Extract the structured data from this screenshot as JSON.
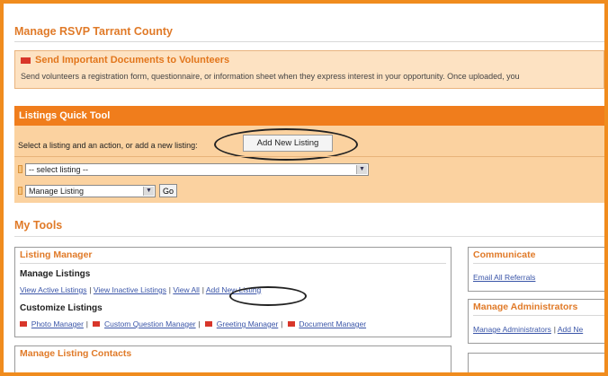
{
  "page": {
    "title": "Manage RSVP Tarrant County"
  },
  "notice": {
    "title": "Send Important Documents to Volunteers",
    "text": "Send volunteers a registration form, questionnaire, or information sheet when they express interest in your opportunity. Once uploaded, you"
  },
  "quick_tool": {
    "title": "Listings Quick Tool",
    "prompt": "Select a listing and an action, or add a new listing:",
    "add_button": "Add New Listing",
    "listing_select": {
      "value": "-- select listing --"
    },
    "action_select": {
      "value": "Manage Listing"
    },
    "go_button": "Go"
  },
  "tools": {
    "title": "My Tools",
    "listing_manager": {
      "title": "Listing Manager",
      "manage_heading": "Manage Listings",
      "manage_links": [
        "View Active Listings",
        "View Inactive Listings",
        "View All",
        "Add New Listing"
      ],
      "customize_heading": "Customize Listings",
      "customize_links": [
        "Photo Manager",
        "Custom Question Manager",
        "Greeting Manager",
        "Document Manager"
      ]
    },
    "contacts": {
      "title": "Manage Listing Contacts"
    },
    "communicate": {
      "title": "Communicate",
      "link": "Email All Referrals"
    },
    "administrators": {
      "title": "Manage Administrators",
      "link1": "Manage Administrators",
      "link2": "Add Ne"
    }
  },
  "colors": {
    "frame": "#f08c1e",
    "accent": "#e07a28",
    "link": "#3a55a8",
    "flag": "#d8362a"
  }
}
